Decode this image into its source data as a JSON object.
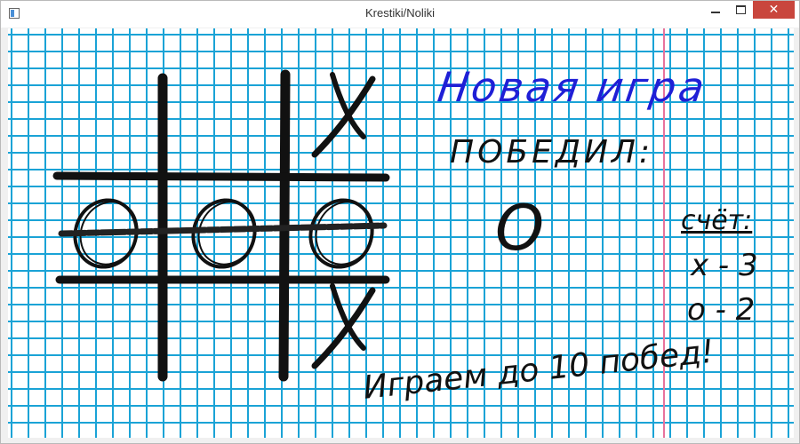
{
  "window": {
    "title": "Krestiki/Noliki",
    "close_glyph": "✕"
  },
  "icons": [
    "app-icon",
    "minimize-icon",
    "maximize-icon",
    "close-icon"
  ],
  "colors": {
    "grid_line": "#1aa3d6",
    "margin_line": "#e8739c",
    "new_game_text": "#1f1fd6",
    "ink": "#111111",
    "close_button": "#c9463d"
  },
  "game": {
    "new_game_label": "Новая игра",
    "winner_label": "ПОБЕДИЛ:",
    "winner_value": "O",
    "board_cells": [
      "",
      "",
      "X",
      "O",
      "O",
      "O",
      "",
      "",
      "X"
    ],
    "win_line": "middle-row",
    "score": {
      "title": "счёт:",
      "x_line": "x - 3",
      "o_line": "o - 2"
    },
    "footer": "Играем до 10 побед!"
  }
}
